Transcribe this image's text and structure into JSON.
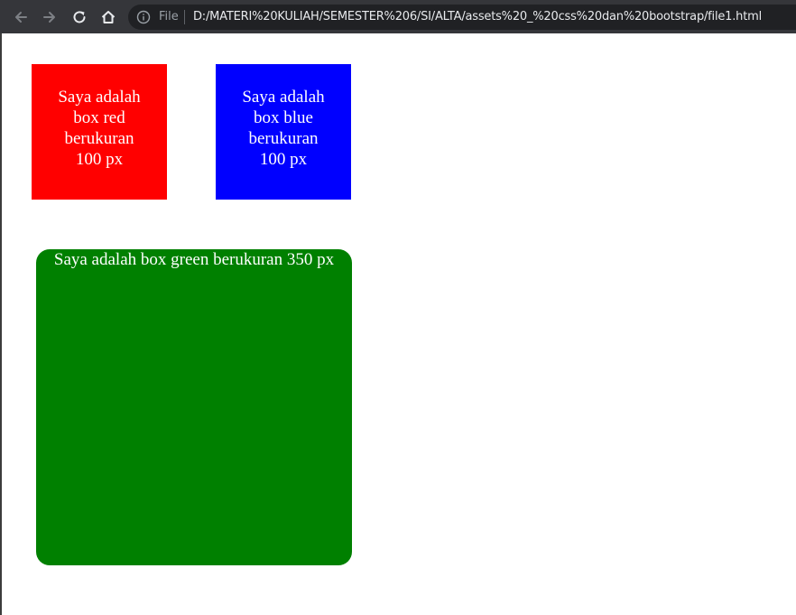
{
  "browser": {
    "url_scheme_label": "File",
    "url": "D:/MATERI%20KULIAH/SEMESTER%206/SI/ALTA/assets%20_%20css%20dan%20bootstrap/file1.html",
    "icons": [
      "back-icon",
      "forward-icon",
      "reload-icon",
      "home-icon",
      "info-icon"
    ]
  },
  "content": {
    "red_box": {
      "text": "Saya adalah box red berukuran 100 px",
      "color": "#ff0000"
    },
    "blue_box": {
      "text": "Saya adalah box blue berukuran 100 px",
      "color": "#0000ff"
    },
    "green_box": {
      "text": "Saya adalah box green berukuran 350 px",
      "color": "#008000"
    }
  }
}
